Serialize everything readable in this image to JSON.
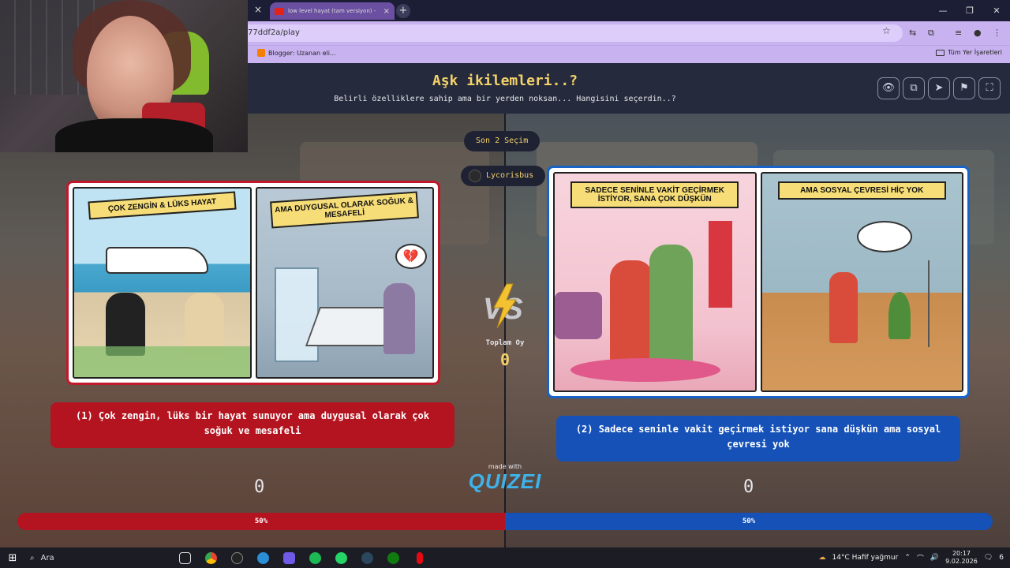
{
  "browser": {
    "tab_title": "low level hayat (tam versiyon) -",
    "url": "77ddf2a/play",
    "bookmark": "Blogger: Uzanan eli...",
    "bookmarks_all": "Tüm Yer İşaretleri",
    "tab_close": "×",
    "new_tab": "+",
    "window_controls": [
      "—",
      "❐",
      "✕"
    ]
  },
  "quiz": {
    "title": "Aşk ikilemleri..?",
    "subtitle": "Belirli özelliklere sahip ama bir yerden noksan... Hangisini seçerdin..?",
    "last_choices": "Son 2 Seçim",
    "player": "Lycorisbus",
    "total_votes_label": "Toplam Oy",
    "total_votes": "0",
    "made_with": "made with",
    "brand": "QUIZEI",
    "header_icons": [
      "eye-icon",
      "share-icon",
      "send-icon",
      "flag-icon",
      "fullscreen-icon"
    ]
  },
  "options": {
    "left": {
      "panel1_ribbon": "ÇOK ZENGİN & LÜKS HAYAT",
      "panel2_ribbon": "AMA DUYGUSAL OLARAK SOĞUK & MESAFELİ",
      "caption": "(1) Çok zengin, lüks bir hayat sunuyor ama duygusal olarak çok soğuk ve mesafeli",
      "votes": "0",
      "percent_label": "50%",
      "percent": 50,
      "color": "#b4141f"
    },
    "right": {
      "panel1_ribbon": "SADECE SENİNLE VAKİT GEÇİRMEK İSTİYOR, SANA ÇOK DÜŞKÜN",
      "panel2_ribbon": "AMA SOSYAL ÇEVRESİ HİÇ YOK",
      "caption": "(2) Sadece seninle vakit geçirmek istiyor sana düşkün ama sosyal çevresi yok",
      "votes": "0",
      "percent_label": "50%",
      "percent": 50,
      "color": "#1651b8"
    }
  },
  "taskbar": {
    "search": "Ara",
    "weather": "14°C  Hafif yağmur",
    "time": "20:17",
    "date": "9.02.2026",
    "notifications": "6"
  }
}
